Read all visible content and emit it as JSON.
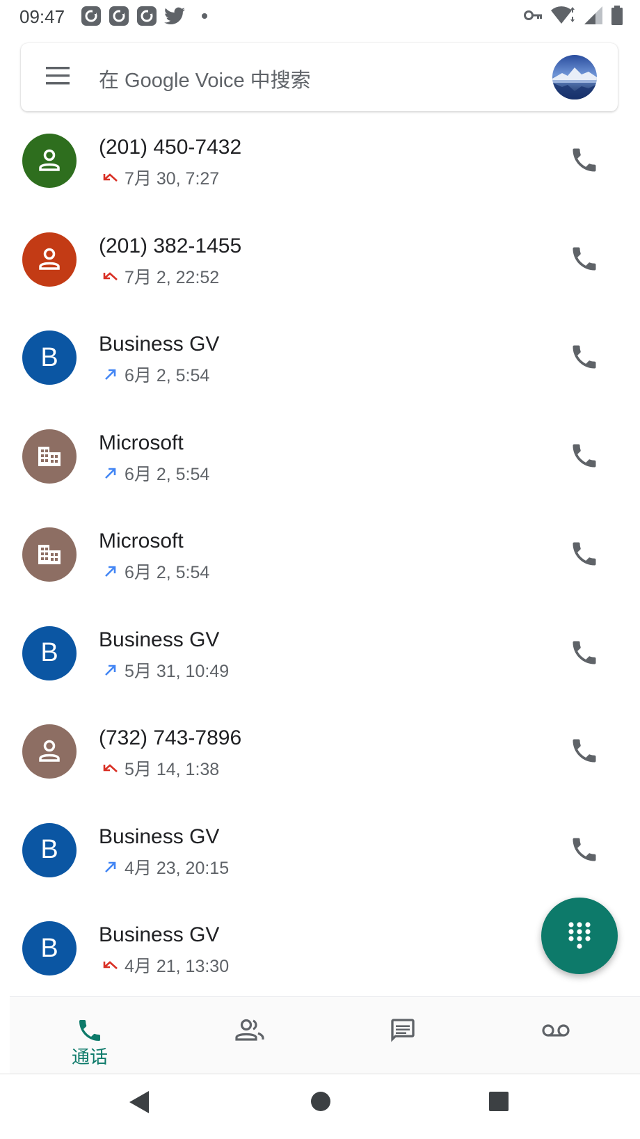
{
  "status_bar": {
    "time": "09:47",
    "left_icons": [
      "notification-icon",
      "notification-icon",
      "notification-icon",
      "twitter-icon",
      "dot-icon"
    ],
    "right_icons": [
      "vpn-key-icon",
      "wifi-icon",
      "signal-icon",
      "battery-icon"
    ]
  },
  "search": {
    "placeholder": "在 Google Voice 中搜索"
  },
  "calls": [
    {
      "name": "(201) 450-7432",
      "time": "7月 30, 7:27",
      "direction": "missed",
      "avatar": "person",
      "color": "#2e6e1e"
    },
    {
      "name": "(201) 382-1455",
      "time": "7月 2, 22:52",
      "direction": "missed",
      "avatar": "person",
      "color": "#c33b15"
    },
    {
      "name": "Business GV",
      "time": "6月 2, 5:54",
      "direction": "outgoing",
      "avatar": "B",
      "color": "#0b56a3"
    },
    {
      "name": "Microsoft",
      "time": "6月 2, 5:54",
      "direction": "outgoing",
      "avatar": "building",
      "color": "#8d6e63"
    },
    {
      "name": "Microsoft",
      "time": "6月 2, 5:54",
      "direction": "outgoing",
      "avatar": "building",
      "color": "#8d6e63"
    },
    {
      "name": "Business GV",
      "time": "5月 31, 10:49",
      "direction": "outgoing",
      "avatar": "B",
      "color": "#0b56a3"
    },
    {
      "name": "(732) 743-7896",
      "time": "5月 14, 1:38",
      "direction": "missed",
      "avatar": "person",
      "color": "#8d6e63"
    },
    {
      "name": "Business GV",
      "time": "4月 23, 20:15",
      "direction": "outgoing",
      "avatar": "B",
      "color": "#0b56a3"
    },
    {
      "name": "Business GV",
      "time": "4月 21, 13:30",
      "direction": "missed",
      "avatar": "B",
      "color": "#0b56a3"
    }
  ],
  "bottom_nav": {
    "tabs": [
      {
        "label": "通话",
        "icon": "phone-icon",
        "active": true
      },
      {
        "label": "",
        "icon": "contacts-icon",
        "active": false
      },
      {
        "label": "",
        "icon": "message-icon",
        "active": false
      },
      {
        "label": "",
        "icon": "voicemail-icon",
        "active": false
      }
    ]
  },
  "colors": {
    "accent": "#0d7a6a",
    "missed": "#d93025",
    "outgoing": "#4285f4",
    "icon_gray": "#5f6368"
  }
}
